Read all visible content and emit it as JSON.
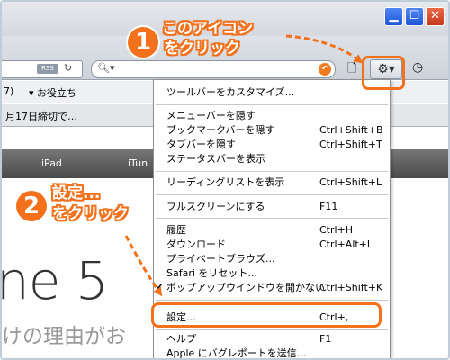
{
  "toolbar": {
    "rss_label": "RSS",
    "reload_icon": "reload-icon",
    "search_icon": "search-icon",
    "clear_icon": "clear-icon",
    "page_icon": "page-icon",
    "gear_icon": "gear-icon",
    "history_icon": "clock-icon"
  },
  "bookmarks": {
    "partial_item": "7)",
    "favorites_label": "お役立ち"
  },
  "tab": {
    "label": "月17日締切で…"
  },
  "page": {
    "nav_items": [
      "iPad",
      "iTun"
    ],
    "big_text": "ne 5",
    "sub_text": "けの理由がお"
  },
  "menu": {
    "items": [
      {
        "label": "ツールバーをカスタマイズ...",
        "shortcut": ""
      },
      {
        "label": "メニューバーを隠す",
        "shortcut": ""
      },
      {
        "label": "ブックマークバーを隠す",
        "shortcut": "Ctrl+Shift+B"
      },
      {
        "label": "タブバーを隠す",
        "shortcut": "Ctrl+Shift+T"
      },
      {
        "label": "ステータスバーを表示",
        "shortcut": ""
      },
      {
        "label": "リーディングリストを表示",
        "shortcut": "Ctrl+Shift+L"
      },
      {
        "label": "フルスクリーンにする",
        "shortcut": "F11"
      },
      {
        "label": "履歴",
        "shortcut": "Ctrl+H"
      },
      {
        "label": "ダウンロード",
        "shortcut": "Ctrl+Alt+L"
      },
      {
        "label": "プライベートブラウズ...",
        "shortcut": ""
      },
      {
        "label": "Safari をリセット...",
        "shortcut": ""
      },
      {
        "label": "ポップアップウインドウを開かない",
        "shortcut": "Ctrl+Shift+K",
        "checked": true
      },
      {
        "label": "設定...",
        "shortcut": "Ctrl+,"
      },
      {
        "label": "ヘルプ",
        "shortcut": "F1"
      },
      {
        "label": "Apple にバグレポートを送信...",
        "shortcut": ""
      }
    ],
    "check_mark": "✔"
  },
  "callouts": {
    "step1_number": "1",
    "step1_line1": "このアイコン",
    "step1_line2": "をクリック",
    "step2_number": "2",
    "step2_line1": "設定...",
    "step2_line2": "をクリック"
  },
  "colors": {
    "accent": "#f3711a"
  }
}
